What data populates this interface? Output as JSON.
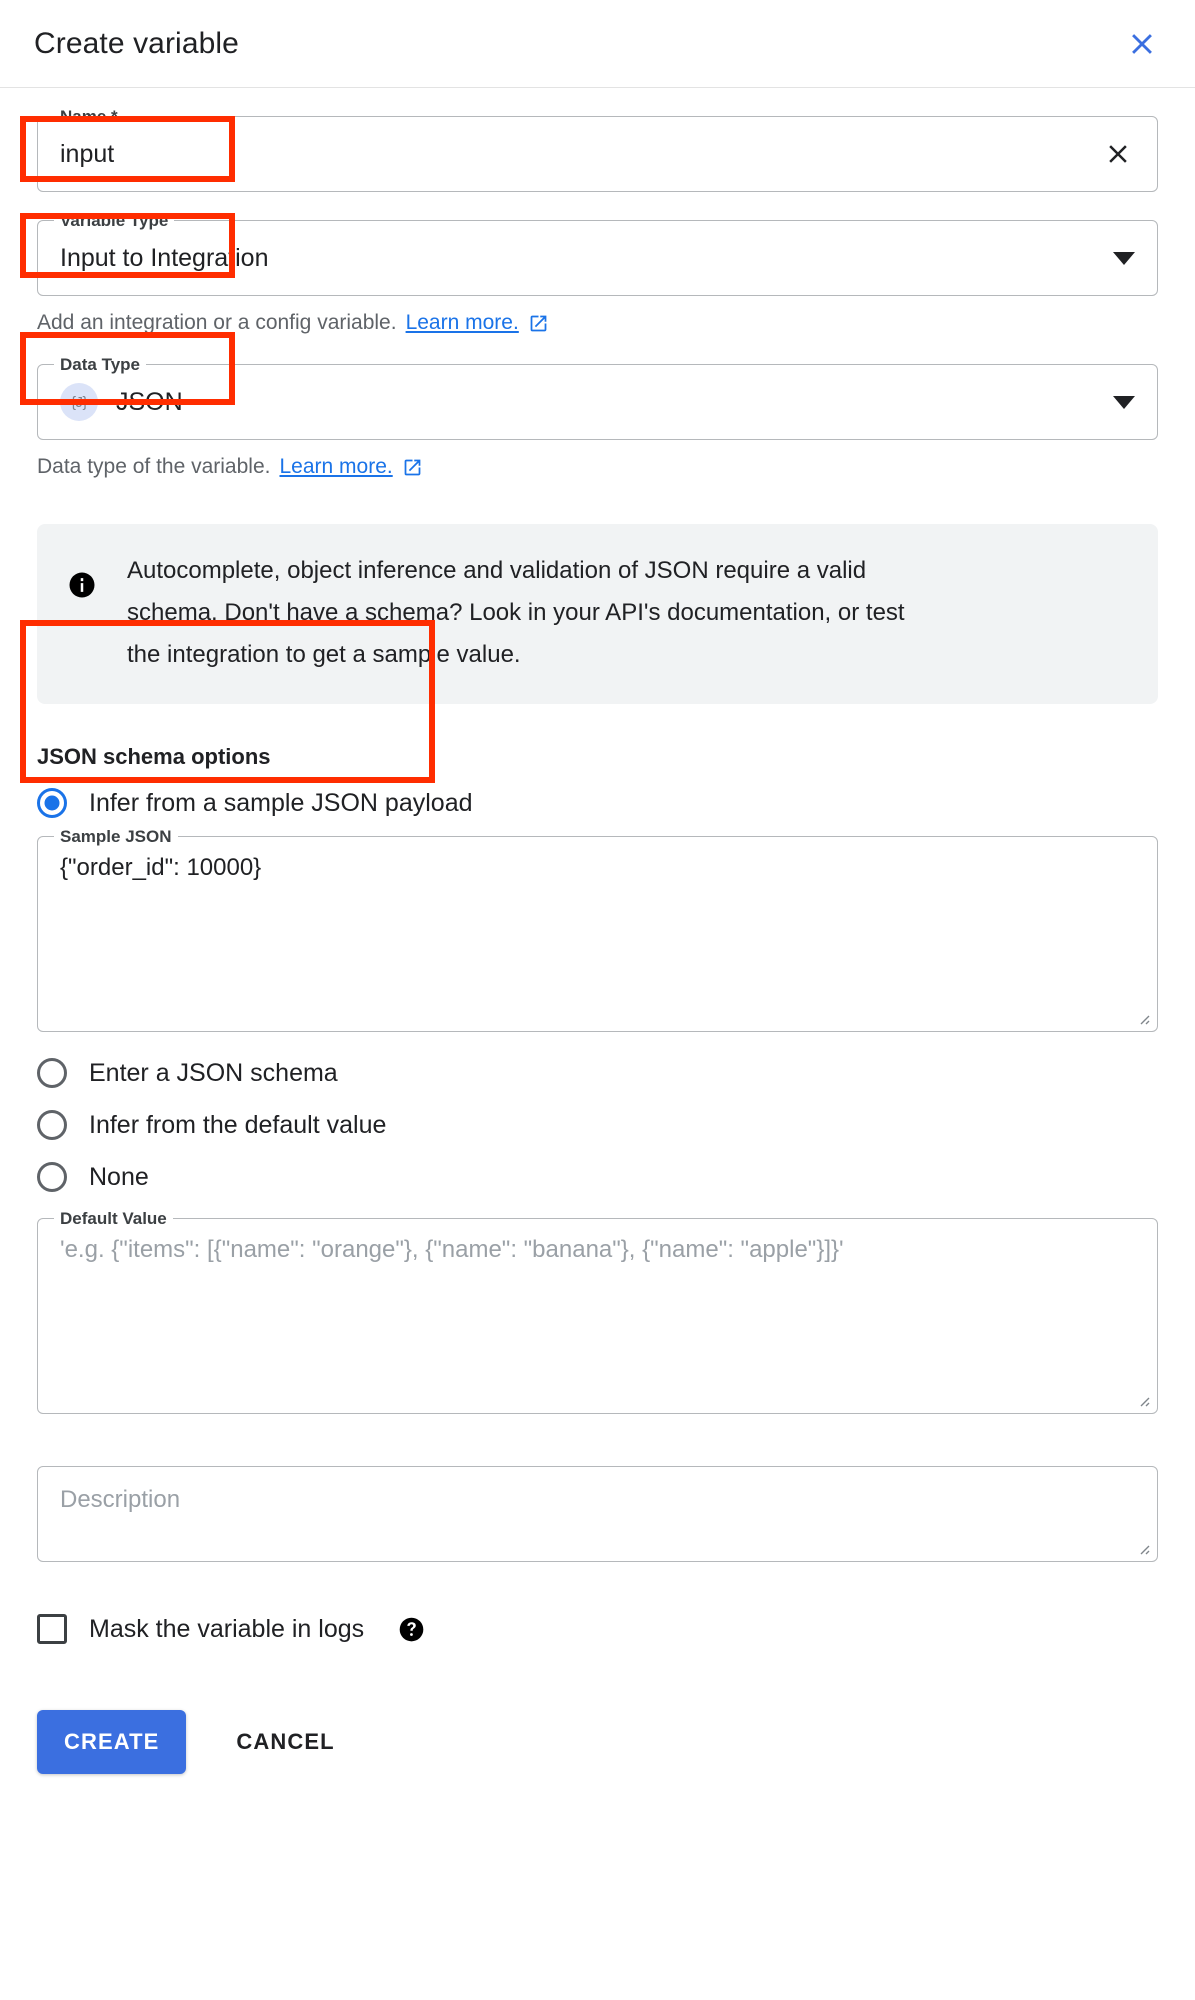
{
  "dialog": {
    "title": "Create variable",
    "close_icon": "close-icon"
  },
  "fields": {
    "name": {
      "label": "Name *",
      "value": "input",
      "clear_icon": "clear-x-icon"
    },
    "variable_type": {
      "label": "Variable Type",
      "value": "Input to Integration",
      "helper_text": "Add an integration or a config variable.",
      "helper_link": "Learn more.",
      "dropdown_icon": "chevron-down-icon",
      "external_link_icon": "external-link-icon"
    },
    "data_type": {
      "label": "Data Type",
      "value": "JSON",
      "badge": "{J}",
      "helper_text": "Data type of the variable.",
      "helper_link": "Learn more.",
      "dropdown_icon": "chevron-down-icon",
      "external_link_icon": "external-link-icon"
    },
    "sample_json": {
      "label": "Sample JSON",
      "value": "{\"order_id\": 10000}"
    },
    "default_value": {
      "label": "Default Value",
      "placeholder": "'e.g. {\"items\": [{\"name\": \"orange\"}, {\"name\": \"banana\"}, {\"name\": \"apple\"}]}'",
      "value": ""
    },
    "description": {
      "placeholder": "Description",
      "value": ""
    }
  },
  "info_banner": {
    "icon": "info-icon",
    "line1": "Autocomplete, object inference and validation of JSON require a valid",
    "line2": "schema. Don't have a schema? Look in your API's documentation, or test",
    "line3": "the integration to get a sample value."
  },
  "schema_options": {
    "title": "JSON schema options",
    "options": [
      {
        "label": "Infer from a sample JSON payload",
        "checked": true
      },
      {
        "label": "Enter a JSON schema",
        "checked": false
      },
      {
        "label": "Infer from the default value",
        "checked": false
      },
      {
        "label": "None",
        "checked": false
      }
    ]
  },
  "mask_checkbox": {
    "label": "Mask the variable in logs",
    "checked": false,
    "help_icon": "help-circle-icon"
  },
  "footer": {
    "create_label": "CREATE",
    "cancel_label": "CANCEL"
  },
  "colors": {
    "accent_blue": "#1a73e8",
    "primary_button": "#3b6fe0",
    "annotation_red": "#ff2d00",
    "banner_bg": "#f1f3f4",
    "json_badge_bg": "#dbe3f8"
  },
  "annotations": [
    {
      "name": "name-field-highlight"
    },
    {
      "name": "variable-type-highlight"
    },
    {
      "name": "data-type-highlight"
    },
    {
      "name": "json-schema-options-highlight"
    }
  ]
}
